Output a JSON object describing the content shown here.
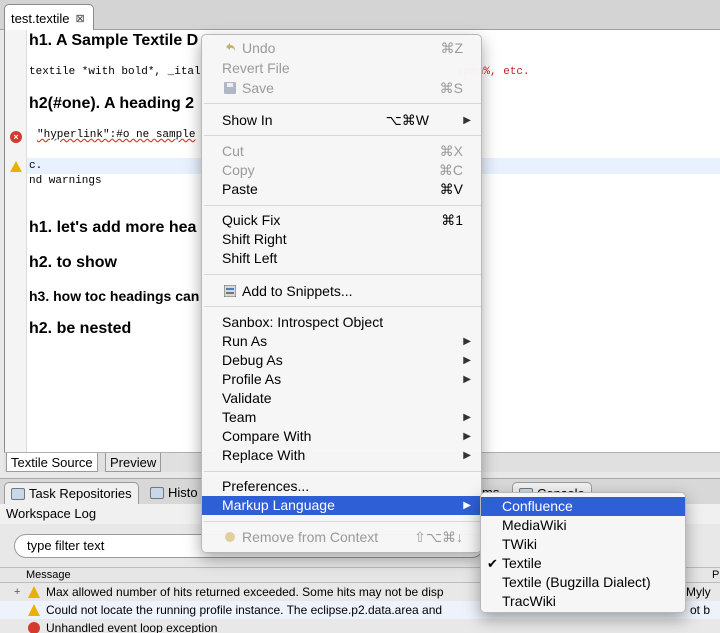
{
  "editor_tab": {
    "title": "test.textile",
    "close": "⊠"
  },
  "editor": {
    "lines": [
      "h1. A Sample Textile D",
      "textile *with bold*, _ital",
      "h2(#one). A heading 2",
      "\"hyperlink\":#o ne sample",
      "c.",
      "nd warnings",
      "h1. let's add more hea",
      "h2. to show",
      "h3. how toc headings can",
      "h2. be nested"
    ],
    "line1_tail": "span%, etc."
  },
  "source_tabs": [
    "Textile Source",
    "Preview"
  ],
  "views_tabs": [
    "Task Repositories",
    "Histo",
    "ms",
    "Console"
  ],
  "workspace_log": "Workspace Log",
  "filter_placeholder": "type filter text",
  "log_headers": {
    "message": "Message",
    "col2": "P"
  },
  "log_rows": [
    {
      "text": "Max allowed number of hits returned exceeded. Some hits may not be disp",
      "tail": "Myly"
    },
    {
      "text": "Could not locate the running profile instance. The eclipse.p2.data.area and",
      "tail": "ot b"
    },
    {
      "text": "Unhandled event loop exception",
      "tail": ""
    }
  ],
  "menu": {
    "undo": {
      "label": "Undo",
      "shortcut": "⌘Z"
    },
    "revert": {
      "label": "Revert File"
    },
    "save": {
      "label": "Save",
      "shortcut": "⌘S"
    },
    "show_in": {
      "label": "Show In",
      "shortcut": "⌥⌘W"
    },
    "cut": {
      "label": "Cut",
      "shortcut": "⌘X"
    },
    "copy": {
      "label": "Copy",
      "shortcut": "⌘C"
    },
    "paste": {
      "label": "Paste",
      "shortcut": "⌘V"
    },
    "quick_fix": {
      "label": "Quick Fix",
      "shortcut": "⌘1"
    },
    "shift_right": {
      "label": "Shift Right"
    },
    "shift_left": {
      "label": "Shift Left"
    },
    "add_snippets": {
      "label": "Add to Snippets..."
    },
    "sanbox": {
      "label": "Sanbox: Introspect Object"
    },
    "run_as": {
      "label": "Run As"
    },
    "debug_as": {
      "label": "Debug As"
    },
    "profile_as": {
      "label": "Profile As"
    },
    "validate": {
      "label": "Validate"
    },
    "team": {
      "label": "Team"
    },
    "compare": {
      "label": "Compare With"
    },
    "replace": {
      "label": "Replace With"
    },
    "preferences": {
      "label": "Preferences..."
    },
    "markup": {
      "label": "Markup Language"
    },
    "remove_context": {
      "label": "Remove from Context",
      "shortcut": "⇧⌥⌘↓"
    }
  },
  "submenu": [
    "Confluence",
    "MediaWiki",
    "TWiki",
    "Textile",
    "Textile (Bugzilla Dialect)",
    "TracWiki"
  ],
  "submenu_checked": "✔",
  "colors": {
    "selection": "#2f5fd6",
    "error": "#d43b2c",
    "warning": "#e8b100"
  }
}
